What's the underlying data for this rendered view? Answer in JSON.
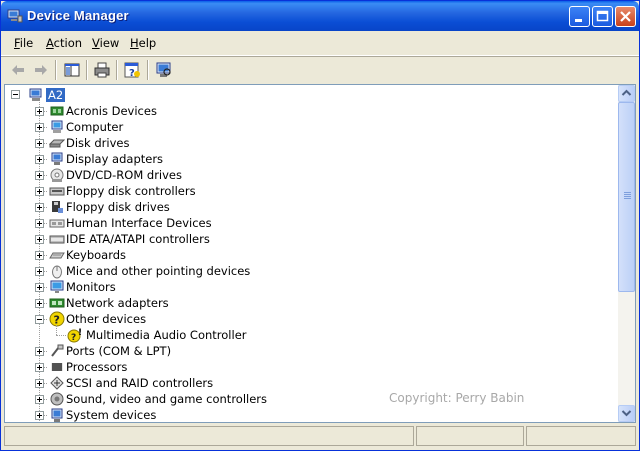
{
  "window": {
    "title": "Device Manager",
    "colors": {
      "titlebar": "#0A4ED5",
      "selection": "#316AC5",
      "workspace": "#ECE9D8"
    }
  },
  "menu": [
    {
      "label": "File"
    },
    {
      "label": "Action"
    },
    {
      "label": "View"
    },
    {
      "label": "Help"
    }
  ],
  "toolbar": {
    "icons": [
      "back-arrow-icon",
      "forward-arrow-icon",
      "show-hide-console-tree-icon",
      "print-icon",
      "help-properties-icon",
      "scan-hardware-icon"
    ]
  },
  "tree": {
    "root": "A2",
    "categories": [
      {
        "label": "Acronis Devices",
        "icon": "acronis-chip-icon",
        "expanded": false
      },
      {
        "label": "Computer",
        "icon": "computer-icon",
        "expanded": false
      },
      {
        "label": "Disk drives",
        "icon": "disk-drive-icon",
        "expanded": false
      },
      {
        "label": "Display adapters",
        "icon": "display-adapter-icon",
        "expanded": false
      },
      {
        "label": "DVD/CD-ROM drives",
        "icon": "dvd-drive-icon",
        "expanded": false
      },
      {
        "label": "Floppy disk controllers",
        "icon": "floppy-controller-icon",
        "expanded": false
      },
      {
        "label": "Floppy disk drives",
        "icon": "floppy-drive-icon",
        "expanded": false
      },
      {
        "label": "Human Interface Devices",
        "icon": "hid-icon",
        "expanded": false
      },
      {
        "label": "IDE ATA/ATAPI controllers",
        "icon": "ide-controller-icon",
        "expanded": false
      },
      {
        "label": "Keyboards",
        "icon": "keyboard-icon",
        "expanded": false
      },
      {
        "label": "Mice and other pointing devices",
        "icon": "mouse-icon",
        "expanded": false
      },
      {
        "label": "Monitors",
        "icon": "monitor-icon",
        "expanded": false
      },
      {
        "label": "Network adapters",
        "icon": "network-adapter-icon",
        "expanded": false
      },
      {
        "label": "Other devices",
        "icon": "unknown-device-icon",
        "expanded": true,
        "children": [
          {
            "label": "Multimedia Audio Controller",
            "icon": "warning-device-icon"
          }
        ]
      },
      {
        "label": "Ports (COM & LPT)",
        "icon": "port-icon",
        "expanded": false
      },
      {
        "label": "Processors",
        "icon": "processor-icon",
        "expanded": false
      },
      {
        "label": "SCSI and RAID controllers",
        "icon": "scsi-icon",
        "expanded": false
      },
      {
        "label": "Sound, video and game controllers",
        "icon": "sound-icon",
        "expanded": false
      },
      {
        "label": "System devices",
        "icon": "system-device-icon",
        "expanded": false
      }
    ]
  },
  "watermark": "Copyright: Perry Babin"
}
